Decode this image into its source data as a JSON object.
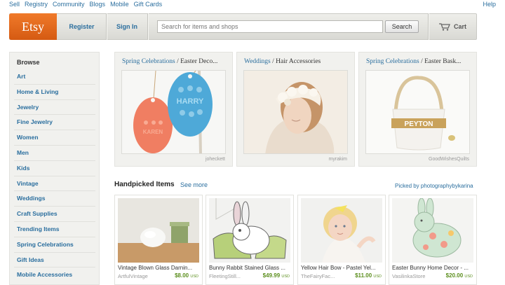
{
  "topnav": {
    "links": [
      "Sell",
      "Registry",
      "Community",
      "Blogs",
      "Mobile",
      "Gift Cards"
    ],
    "help": "Help"
  },
  "header": {
    "logo": "Etsy",
    "register": "Register",
    "signin": "Sign In",
    "search_placeholder": "Search for items and shops",
    "search_button": "Search",
    "cart": "Cart"
  },
  "sidebar": {
    "title": "Browse",
    "items": [
      "Art",
      "Home & Living",
      "Jewelry",
      "Fine Jewelry",
      "Women",
      "Men",
      "Kids",
      "Vintage",
      "Weddings",
      "Craft Supplies",
      "Trending Items",
      "Spring Celebrations",
      "Gift Ideas",
      "Mobile Accessories"
    ]
  },
  "featured": [
    {
      "category": "Spring Celebrations",
      "sub": " / Easter Deco...",
      "credit": "joheckett"
    },
    {
      "category": "Weddings",
      "sub": " / Hair Accessories",
      "credit": "myrakim"
    },
    {
      "category": "Spring Celebrations",
      "sub": " / Easter Bask...",
      "credit": "GoodWishesQuilts"
    }
  ],
  "egg_text": {
    "blue": "HARRY",
    "pink": "KAREN",
    "basket": "PEYTON"
  },
  "handpicked": {
    "title": "Handpicked Items",
    "see_more": "See more",
    "picked_by": "Picked by photographybykarina",
    "items": [
      {
        "title": "Vintage Blown Glass Darnin...",
        "shop": "ArtfulVintage",
        "price": "$8.00",
        "currency": "USD"
      },
      {
        "title": "Bunny Rabbit Stained Glass ...",
        "shop": "FleetingStill...",
        "price": "$49.99",
        "currency": "USD"
      },
      {
        "title": "Yellow Hair Bow - Pastel Yel...",
        "shop": "TheFairyFac...",
        "price": "$11.00",
        "currency": "USD"
      },
      {
        "title": "Easter Bunny Home Decor - ...",
        "shop": "VasilinkaStore",
        "price": "$20.00",
        "currency": "USD"
      }
    ]
  },
  "colors": {
    "brand_orange": "#e56a1c",
    "link_blue": "#2a6e9e",
    "price_green": "#5c8f1e"
  }
}
